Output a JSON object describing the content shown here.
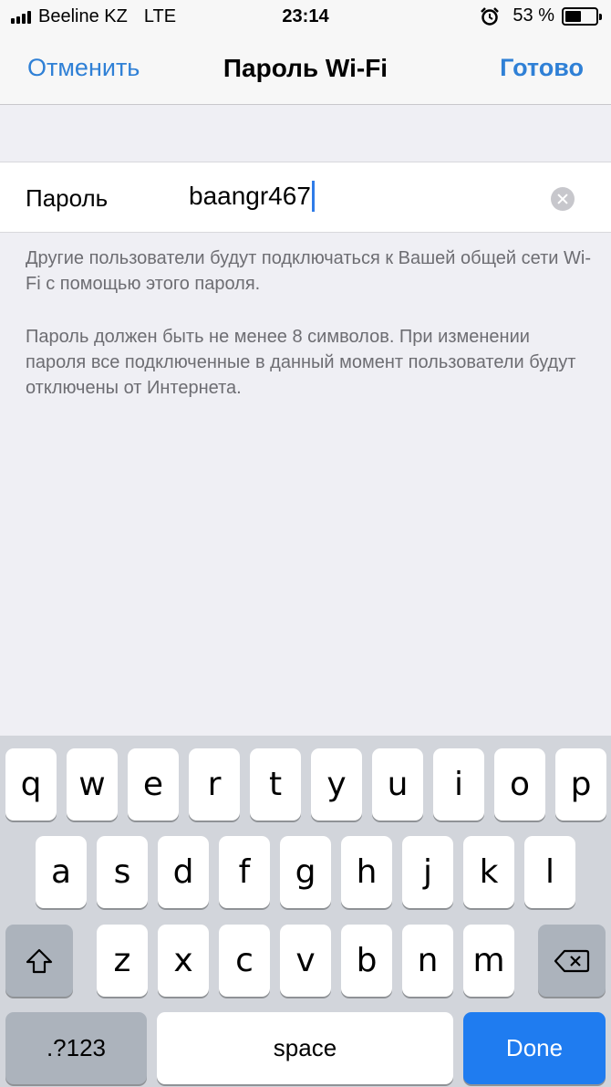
{
  "status_bar": {
    "carrier": "Beeline KZ",
    "network": "LTE",
    "time": "23:14",
    "battery": "53 %",
    "battery_level": 0.53,
    "icons": [
      "signal-icon",
      "alarm-icon",
      "battery-icon"
    ]
  },
  "nav": {
    "cancel_label": "Отменить",
    "title": "Пароль Wi-Fi",
    "done_label": "Готово"
  },
  "password_field": {
    "label": "Пароль",
    "value": "baangr467"
  },
  "footnotes": {
    "line1": "Другие пользователи будут подключаться к Вашей общей сети Wi-Fi с помощью этого пароля.",
    "line2": "Пароль должен быть не менее 8 символов. При изменении пароля все подключенные в данный момент пользователи будут отключены от Интернета."
  },
  "keyboard": {
    "row1": [
      "q",
      "w",
      "e",
      "r",
      "t",
      "y",
      "u",
      "i",
      "o",
      "p"
    ],
    "row2": [
      "a",
      "s",
      "d",
      "f",
      "g",
      "h",
      "j",
      "k",
      "l"
    ],
    "row3": [
      "z",
      "x",
      "c",
      "v",
      "b",
      "n",
      "m"
    ],
    "numbers_label": ".?123",
    "space_label": "space",
    "done_label": "Done",
    "shift_icon": "shift-icon",
    "backspace_icon": "backspace-icon"
  },
  "colors": {
    "accent": "#2f80d6",
    "done_key": "#1f7cf0",
    "caret": "#2f7ce8"
  }
}
